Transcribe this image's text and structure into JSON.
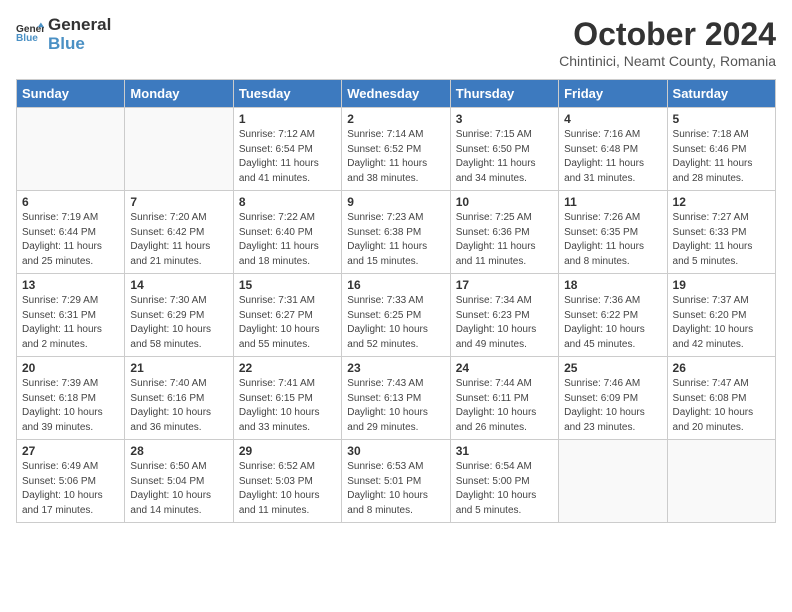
{
  "logo": {
    "general": "General",
    "blue": "Blue"
  },
  "title": "October 2024",
  "subtitle": "Chintinici, Neamt County, Romania",
  "weekdays": [
    "Sunday",
    "Monday",
    "Tuesday",
    "Wednesday",
    "Thursday",
    "Friday",
    "Saturday"
  ],
  "weeks": [
    [
      {
        "day": "",
        "empty": true
      },
      {
        "day": "",
        "empty": true
      },
      {
        "day": "1",
        "sunrise": "7:12 AM",
        "sunset": "6:54 PM",
        "daylight": "11 hours and 41 minutes."
      },
      {
        "day": "2",
        "sunrise": "7:14 AM",
        "sunset": "6:52 PM",
        "daylight": "11 hours and 38 minutes."
      },
      {
        "day": "3",
        "sunrise": "7:15 AM",
        "sunset": "6:50 PM",
        "daylight": "11 hours and 34 minutes."
      },
      {
        "day": "4",
        "sunrise": "7:16 AM",
        "sunset": "6:48 PM",
        "daylight": "11 hours and 31 minutes."
      },
      {
        "day": "5",
        "sunrise": "7:18 AM",
        "sunset": "6:46 PM",
        "daylight": "11 hours and 28 minutes."
      }
    ],
    [
      {
        "day": "6",
        "sunrise": "7:19 AM",
        "sunset": "6:44 PM",
        "daylight": "11 hours and 25 minutes."
      },
      {
        "day": "7",
        "sunrise": "7:20 AM",
        "sunset": "6:42 PM",
        "daylight": "11 hours and 21 minutes."
      },
      {
        "day": "8",
        "sunrise": "7:22 AM",
        "sunset": "6:40 PM",
        "daylight": "11 hours and 18 minutes."
      },
      {
        "day": "9",
        "sunrise": "7:23 AM",
        "sunset": "6:38 PM",
        "daylight": "11 hours and 15 minutes."
      },
      {
        "day": "10",
        "sunrise": "7:25 AM",
        "sunset": "6:36 PM",
        "daylight": "11 hours and 11 minutes."
      },
      {
        "day": "11",
        "sunrise": "7:26 AM",
        "sunset": "6:35 PM",
        "daylight": "11 hours and 8 minutes."
      },
      {
        "day": "12",
        "sunrise": "7:27 AM",
        "sunset": "6:33 PM",
        "daylight": "11 hours and 5 minutes."
      }
    ],
    [
      {
        "day": "13",
        "sunrise": "7:29 AM",
        "sunset": "6:31 PM",
        "daylight": "11 hours and 2 minutes."
      },
      {
        "day": "14",
        "sunrise": "7:30 AM",
        "sunset": "6:29 PM",
        "daylight": "10 hours and 58 minutes."
      },
      {
        "day": "15",
        "sunrise": "7:31 AM",
        "sunset": "6:27 PM",
        "daylight": "10 hours and 55 minutes."
      },
      {
        "day": "16",
        "sunrise": "7:33 AM",
        "sunset": "6:25 PM",
        "daylight": "10 hours and 52 minutes."
      },
      {
        "day": "17",
        "sunrise": "7:34 AM",
        "sunset": "6:23 PM",
        "daylight": "10 hours and 49 minutes."
      },
      {
        "day": "18",
        "sunrise": "7:36 AM",
        "sunset": "6:22 PM",
        "daylight": "10 hours and 45 minutes."
      },
      {
        "day": "19",
        "sunrise": "7:37 AM",
        "sunset": "6:20 PM",
        "daylight": "10 hours and 42 minutes."
      }
    ],
    [
      {
        "day": "20",
        "sunrise": "7:39 AM",
        "sunset": "6:18 PM",
        "daylight": "10 hours and 39 minutes."
      },
      {
        "day": "21",
        "sunrise": "7:40 AM",
        "sunset": "6:16 PM",
        "daylight": "10 hours and 36 minutes."
      },
      {
        "day": "22",
        "sunrise": "7:41 AM",
        "sunset": "6:15 PM",
        "daylight": "10 hours and 33 minutes."
      },
      {
        "day": "23",
        "sunrise": "7:43 AM",
        "sunset": "6:13 PM",
        "daylight": "10 hours and 29 minutes."
      },
      {
        "day": "24",
        "sunrise": "7:44 AM",
        "sunset": "6:11 PM",
        "daylight": "10 hours and 26 minutes."
      },
      {
        "day": "25",
        "sunrise": "7:46 AM",
        "sunset": "6:09 PM",
        "daylight": "10 hours and 23 minutes."
      },
      {
        "day": "26",
        "sunrise": "7:47 AM",
        "sunset": "6:08 PM",
        "daylight": "10 hours and 20 minutes."
      }
    ],
    [
      {
        "day": "27",
        "sunrise": "6:49 AM",
        "sunset": "5:06 PM",
        "daylight": "10 hours and 17 minutes."
      },
      {
        "day": "28",
        "sunrise": "6:50 AM",
        "sunset": "5:04 PM",
        "daylight": "10 hours and 14 minutes."
      },
      {
        "day": "29",
        "sunrise": "6:52 AM",
        "sunset": "5:03 PM",
        "daylight": "10 hours and 11 minutes."
      },
      {
        "day": "30",
        "sunrise": "6:53 AM",
        "sunset": "5:01 PM",
        "daylight": "10 hours and 8 minutes."
      },
      {
        "day": "31",
        "sunrise": "6:54 AM",
        "sunset": "5:00 PM",
        "daylight": "10 hours and 5 minutes."
      },
      {
        "day": "",
        "empty": true
      },
      {
        "day": "",
        "empty": true
      }
    ]
  ],
  "labels": {
    "sunrise": "Sunrise:",
    "sunset": "Sunset:",
    "daylight": "Daylight:"
  }
}
